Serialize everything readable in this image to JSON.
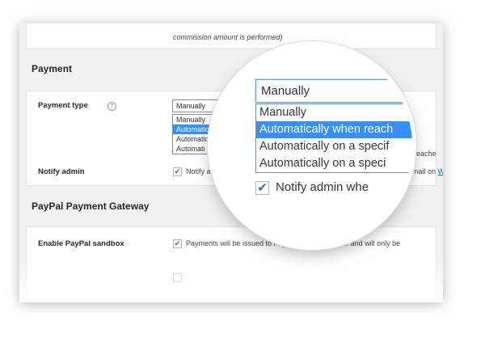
{
  "top_note": "commission amount is performed)",
  "payment": {
    "title": "Payment",
    "payment_type_label": "Payment type",
    "help_icon": "question-circle-icon",
    "selected": "Manually",
    "options_small": [
      "Manually",
      "Automatic",
      "Automatic",
      "Automati"
    ],
    "notify_admin_label": "Notify admin",
    "notify_small_text": "Notify ad",
    "reached_fragment": "is reache",
    "email_fragment": "email on",
    "email_link_fragment": "W"
  },
  "magnifier": {
    "selected": "Manually",
    "options": [
      "Manually",
      "Automatically when reach",
      "Automatically on a specif",
      "Automatically on a speci"
    ],
    "notify_text": "Notify admin whe",
    "check_icon": "checkmark-icon"
  },
  "paypal": {
    "title": "PayPal Payment Gateway",
    "sandbox_label": "Enable PayPal sandbox",
    "sandbox_text": "Payments will be issued to PayPal sandbox server and will only be"
  },
  "colors": {
    "selection": "#3390ff",
    "checkmark": "#1e73be",
    "focus_border": "#5b9dd9"
  }
}
